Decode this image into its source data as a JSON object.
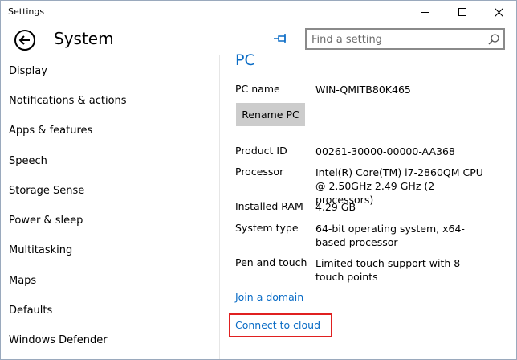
{
  "window": {
    "title": "Settings"
  },
  "header": {
    "page_title": "System",
    "search_placeholder": "Find a setting"
  },
  "sidebar": {
    "items": [
      {
        "label": "Display"
      },
      {
        "label": "Notifications & actions"
      },
      {
        "label": "Apps & features"
      },
      {
        "label": "Speech"
      },
      {
        "label": "Storage Sense"
      },
      {
        "label": "Power & sleep"
      },
      {
        "label": "Multitasking"
      },
      {
        "label": "Maps"
      },
      {
        "label": "Defaults"
      },
      {
        "label": "Windows Defender"
      }
    ]
  },
  "main": {
    "section_title": "PC",
    "pc_name_label": "PC name",
    "pc_name_value": "WIN-QMITB80K465",
    "rename_button": "Rename PC",
    "product_id_label": "Product ID",
    "product_id_value": "00261-30000-00000-AA368",
    "processor_label": "Processor",
    "processor_value": "Intel(R) Core(TM) i7-2860QM CPU @ 2.50GHz   2.49 GHz  (2 processors)",
    "ram_label": "Installed RAM",
    "ram_value": "4.29 GB",
    "system_type_label": "System type",
    "system_type_value": "64-bit operating system, x64-based processor",
    "pen_touch_label": "Pen and touch",
    "pen_touch_value": "Limited touch support with 8 touch points",
    "join_domain_link": "Join a domain",
    "connect_cloud_link": "Connect to cloud"
  },
  "colors": {
    "accent": "#0a6cc6",
    "highlight": "#e02020",
    "button_bg": "#cccccc"
  },
  "icons": {
    "back": "back-arrow-icon",
    "pin": "pin-icon",
    "search": "search-icon",
    "minimize": "minimize-icon",
    "maximize": "maximize-icon",
    "close": "close-icon"
  }
}
